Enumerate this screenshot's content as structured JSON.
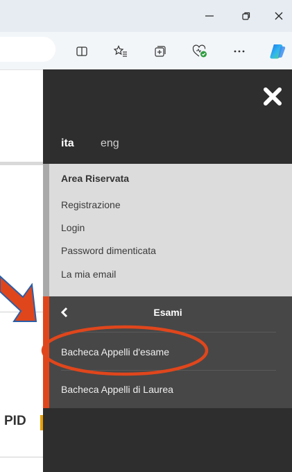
{
  "menu": {
    "languages": {
      "ita": "ita",
      "eng": "eng"
    },
    "reserved_area": {
      "title": "Area Riservata",
      "items": [
        "Registrazione",
        "Login",
        "Password dimenticata",
        "La mia email"
      ]
    },
    "exams": {
      "title": "Esami",
      "items": [
        "Bacheca Appelli d'esame",
        "Bacheca Appelli di Laurea"
      ]
    }
  },
  "page": {
    "partial_heading": "PID"
  },
  "colors": {
    "menu_bg": "#2e2e2e",
    "reserved_bg": "#dcdcdc",
    "exams_bg": "#474747",
    "accent": "#e0461c",
    "annotation": "#e0461c"
  }
}
